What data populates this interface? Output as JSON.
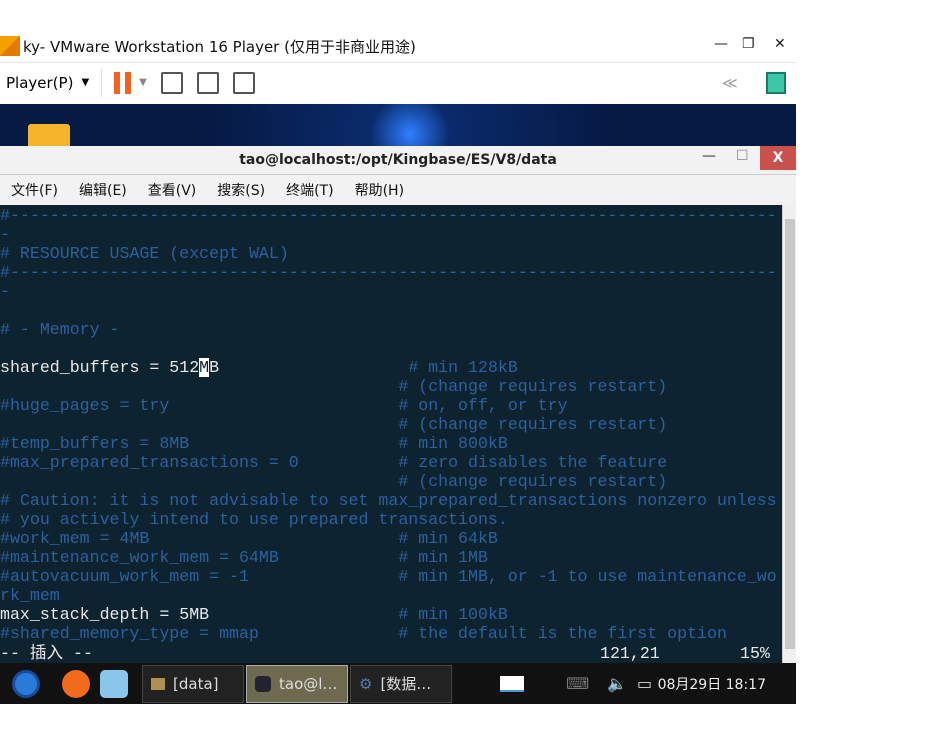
{
  "vmware": {
    "title": "ky- VMware Workstation 16 Player (仅用于非商业用途)",
    "player_menu": "Player(P)",
    "min": "—",
    "restore": "❐",
    "close": "✕",
    "collapse": "≪"
  },
  "terminal": {
    "title": "tao@localhost:/opt/Kingbase/ES/V8/data",
    "min": "—",
    "max": "☐",
    "close": "X",
    "menu": [
      "文件(F)",
      "编辑(E)",
      "查看(V)",
      "搜索(S)",
      "终端(T)",
      "帮助(H)"
    ],
    "lines": [
      {
        "code": "",
        "comment": "#-----------------------------------------------------------------------------"
      },
      {
        "code": "",
        "comment": "-"
      },
      {
        "code": "",
        "comment": "# RESOURCE USAGE (except WAL)"
      },
      {
        "code": "",
        "comment": "#-----------------------------------------------------------------------------"
      },
      {
        "code": "",
        "comment": "-"
      },
      {
        "code": "",
        "comment": ""
      },
      {
        "code": "",
        "comment": "# - Memory -"
      },
      {
        "code": "",
        "comment": ""
      },
      {
        "code": "shared_buffers = 512",
        "cursor": "M",
        "code2": "B                   ",
        "comment": "# min 128kB"
      },
      {
        "code": "",
        "comment": "                                        # (change requires restart)"
      },
      {
        "code": "",
        "comment": "#huge_pages = try                       # on, off, or try"
      },
      {
        "code": "",
        "comment": "                                        # (change requires restart)"
      },
      {
        "code": "",
        "comment": "#temp_buffers = 8MB                     # min 800kB"
      },
      {
        "code": "",
        "comment": "#max_prepared_transactions = 0          # zero disables the feature"
      },
      {
        "code": "",
        "comment": "                                        # (change requires restart)"
      },
      {
        "code": "",
        "comment": "# Caution: it is not advisable to set max_prepared_transactions nonzero unless"
      },
      {
        "code": "",
        "comment": "# you actively intend to use prepared transactions."
      },
      {
        "code": "",
        "comment": "#work_mem = 4MB                         # min 64kB"
      },
      {
        "code": "",
        "comment": "#maintenance_work_mem = 64MB            # min 1MB"
      },
      {
        "code": "",
        "comment": "#autovacuum_work_mem = -1               # min 1MB, or -1 to use maintenance_wo"
      },
      {
        "code": "",
        "comment": "rk_mem"
      },
      {
        "code": "max_stack_depth = 5MB                   ",
        "comment": "# min 100kB"
      },
      {
        "code": "",
        "comment": "#shared_memory_type = mmap              # the default is the first option"
      }
    ],
    "status_mode": "-- 插入 --",
    "status_pos": "121,21",
    "status_pct": "15%"
  },
  "taskbar": {
    "tasks": [
      "[data]",
      "tao@l…",
      "[数据…"
    ],
    "clock": "08月29日 18:17"
  }
}
